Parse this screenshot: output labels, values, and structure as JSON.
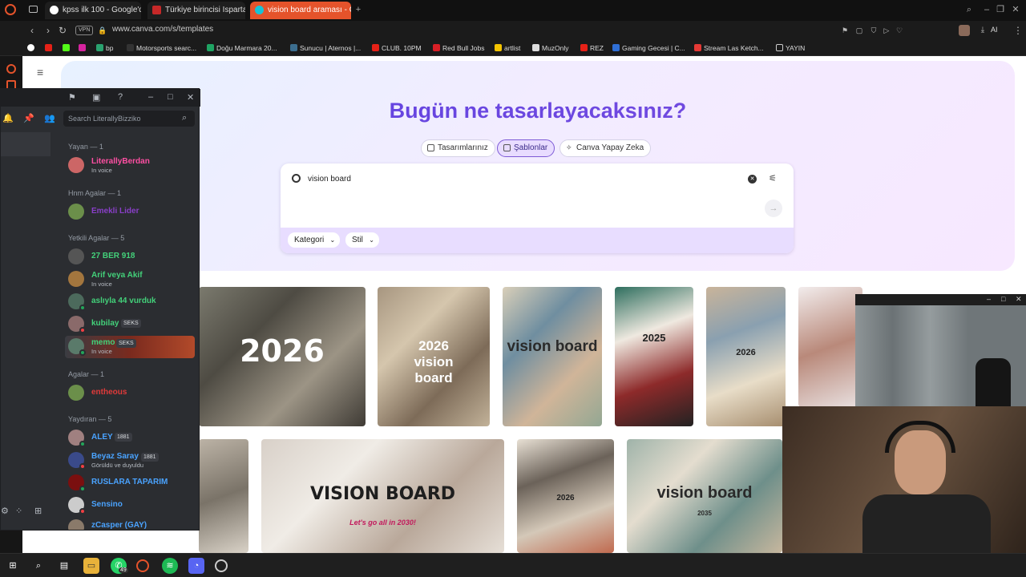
{
  "browser": {
    "tabs": [
      {
        "label": "kpss ilk 100 - Google'da A",
        "active": false
      },
      {
        "label": "Türkiye birincisi Isparta'da",
        "active": false
      },
      {
        "label": "vision board araması - Can",
        "active": true
      }
    ],
    "url": "www.canva.com/s/templates",
    "vpn_label": "VPN",
    "ai_label": "AI",
    "bookmarks": [
      "bp",
      "Motorsports searc...",
      "Doğu Marmara 20...",
      "Sunucu | Aternos |...",
      "CLUB. 10PM",
      "Red Bull Jobs",
      "artlist",
      "MuzOnly",
      "REZ",
      "Gaming Gecesi | C...",
      "Stream Las Ketch...",
      "YAYIN"
    ]
  },
  "canva": {
    "title": "Bugün ne tasarlayacaksınız?",
    "tabs": [
      {
        "label": "Tasarımlarınız",
        "active": false
      },
      {
        "label": "Şablonlar",
        "active": true
      },
      {
        "label": "Canva Yapay Zeka",
        "active": false
      }
    ],
    "search": {
      "value": "vision board"
    },
    "filters": [
      "Kategori",
      "Stil"
    ],
    "thumb_texts": [
      "2026",
      "2026 vision board",
      "vision board",
      "2025",
      "2026",
      "VISION BOARD",
      "Let's go all in 2030!",
      "2026",
      "vision board",
      "2035"
    ]
  },
  "discord": {
    "search_placeholder": "Search LiterallyBizziko",
    "sections": [
      {
        "title": "Yayan — 1",
        "members": [
          {
            "name": "LiterallyBerdan",
            "sub": "In voice",
            "color": "#ff4fa3"
          }
        ]
      },
      {
        "title": "Hnm Agalar — 1",
        "members": [
          {
            "name": "Emekli Lider",
            "sub": "",
            "color": "#8a3fc9"
          }
        ]
      },
      {
        "title": "Yetkili Agalar — 5",
        "members": [
          {
            "name": "27 BER 918",
            "sub": "",
            "color": "#43d17a"
          },
          {
            "name": "Arif veya Akif",
            "sub": "In voice",
            "color": "#43d17a"
          },
          {
            "name": "aslıyla 44 vurduk",
            "sub": "",
            "color": "#43d17a"
          },
          {
            "name": "kubilay",
            "sub": "",
            "color": "#43d17a",
            "tag": "SEKS"
          },
          {
            "name": "memo",
            "sub": "In voice",
            "color": "#43d17a",
            "tag": "SEKS"
          }
        ]
      },
      {
        "title": "Agalar — 1",
        "members": [
          {
            "name": "entheous",
            "sub": "",
            "color": "#e03a3a"
          }
        ]
      },
      {
        "title": "Yaydıran — 5",
        "members": [
          {
            "name": "ALEY",
            "sub": "",
            "color": "#4aa3ff",
            "tag": "1881"
          },
          {
            "name": "Beyaz Saray",
            "sub": "Görüldü ve duyuldu",
            "color": "#4aa3ff",
            "tag": "1881"
          },
          {
            "name": "RUSLARA TAPARIM",
            "sub": "",
            "color": "#4aa3ff"
          },
          {
            "name": "Sensino",
            "sub": "",
            "color": "#4aa3ff"
          },
          {
            "name": "zCasper (GAY)",
            "sub": "",
            "color": "#4aa3ff"
          }
        ]
      }
    ]
  },
  "taskbar": {
    "whatsapp_badge": "49"
  }
}
